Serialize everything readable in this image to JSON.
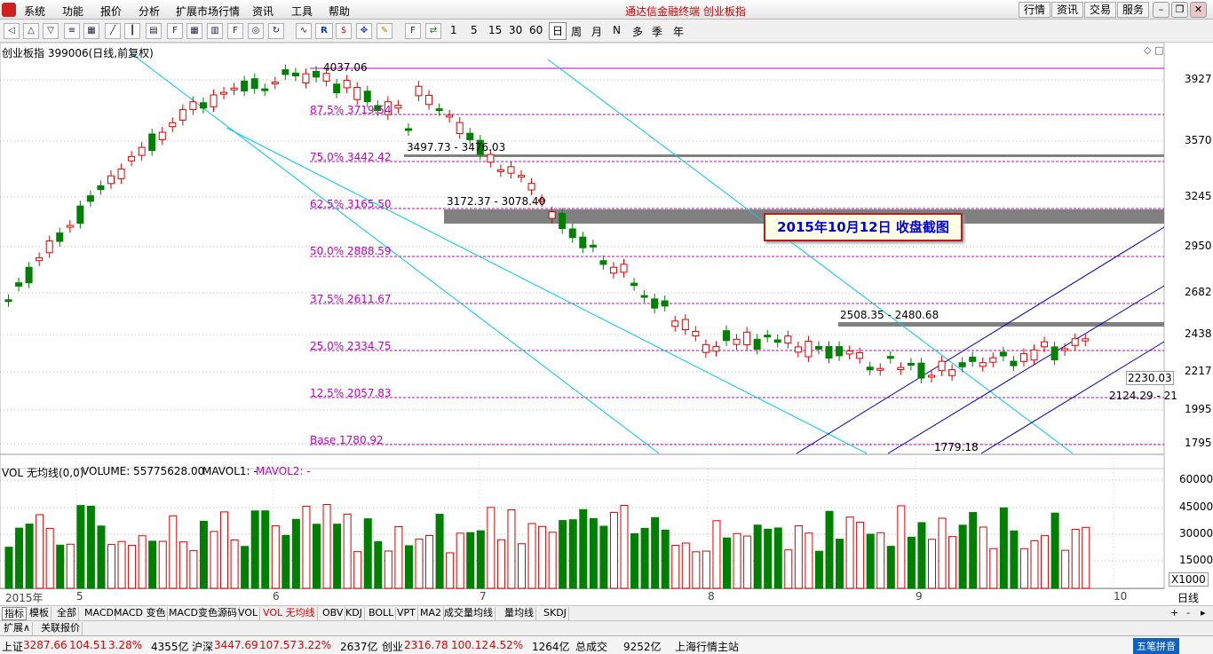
{
  "menu": {
    "items": [
      "系统",
      "功能",
      "报价",
      "分析",
      "扩展市场行情",
      "资讯",
      "工具",
      "帮助"
    ],
    "app_title": "通达信金融终端   创业板指",
    "right_buttons": [
      "行情",
      "资讯",
      "交易",
      "服务"
    ]
  },
  "toolbar": {
    "periods": [
      "1",
      "5",
      "15",
      "30",
      "60",
      "日",
      "周",
      "月",
      "N",
      "多",
      "季",
      "年"
    ],
    "active_period": "日"
  },
  "chart": {
    "title": "创业板指 399006(日线,前复权)",
    "y_labels": [
      "3927",
      "3570",
      "3245",
      "2950",
      "2682",
      "2438",
      "2217",
      "1995",
      "1795"
    ],
    "fib_levels": [
      "87.5% 3719.54",
      "75.0% 3442.42",
      "62.5% 3165.50",
      "50.0% 2888.59",
      "37.5% 2611.67",
      "25.0% 2334.75",
      "12.5% 2057.83",
      "Base 1780.92"
    ],
    "high_label": "4037.06",
    "low_label": "1779.18",
    "zone_labels": [
      "3497.73 - 3476.03",
      "3172.37 - 3078.40",
      "2508.35 - 2480.68",
      "2124.29 - 21"
    ],
    "last_price": "2230.03",
    "banner": "2015年10月12日  收盘截图",
    "colors": {
      "up": "#e00000",
      "down": "#008000",
      "fib": "#c000c0",
      "cyan_channel": "#00c8e8",
      "blue_channel": "#0000c0",
      "zone": "#808080"
    }
  },
  "volume": {
    "title": "VOL 无均线(0,0)",
    "volume_label": "VOLUME: 55775628.00",
    "mavol1": "MAVOL1: -",
    "mavol2": "MAVOL2: -",
    "y_labels": [
      "60000",
      "45000",
      "30000",
      "15000",
      "X1000"
    ]
  },
  "date_axis": {
    "labels": [
      "2015年",
      "5",
      "6",
      "7",
      "8",
      "9",
      "10"
    ]
  },
  "period_indicator": "日线",
  "indicator_tabs": [
    "指标",
    "模板",
    "全部",
    "MACD",
    "MACD 变色",
    "MACD变色源码",
    "VOL",
    "VOL 无均线",
    "OBV",
    "KDJ",
    "BOLL",
    "VPT",
    "MA2",
    "成交量均线",
    "量均线",
    "SKDJ"
  ],
  "active_indicator_tab": "VOL 无均线",
  "ext_tabs": [
    "扩展∧",
    "关联报价"
  ],
  "status_bar": {
    "sh_label": "上证",
    "sh_value": "3287.66",
    "sh_change": "104.51",
    "sh_pct": "3.28%",
    "sh_amount": "4355亿",
    "hs_label": "沪深",
    "hs_value": "3447.69",
    "hs_change": "107.57",
    "hs_pct": "3.22%",
    "hs_amount": "2637亿",
    "cy_label": "创业",
    "cy_value": "2316.78",
    "cy_change": "100.12",
    "cy_pct": "4.52%",
    "cy_amount": "1264亿",
    "total_label": "总成交",
    "total_amount": "9252亿",
    "server": "上海行情主站",
    "ime": "五笔拼音"
  }
}
